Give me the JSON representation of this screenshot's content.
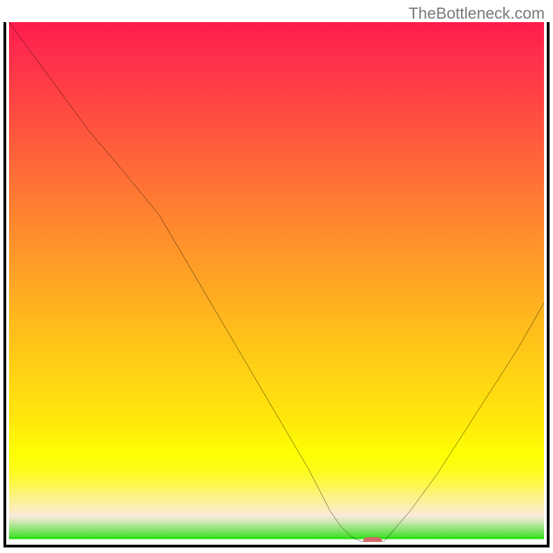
{
  "watermark": "TheBottleneck.com",
  "chart_data": {
    "type": "line",
    "title": "",
    "xlabel": "",
    "ylabel": "",
    "xlim": [
      0,
      100
    ],
    "ylim": [
      0,
      100
    ],
    "x": [
      0,
      5,
      10,
      15,
      20,
      24,
      28,
      32,
      36,
      40,
      44,
      48,
      52,
      56,
      58,
      60,
      62,
      64,
      66,
      70,
      75,
      80,
      85,
      90,
      95,
      100
    ],
    "values": [
      100,
      93,
      86,
      79,
      73,
      68,
      63,
      56,
      49,
      42,
      35,
      28,
      21,
      14,
      10,
      6,
      3,
      1,
      0,
      0,
      6,
      13,
      21,
      29,
      37,
      46
    ],
    "marker": {
      "x": 68,
      "y": 0
    },
    "annotations": [],
    "legend": [],
    "gradient_colors": {
      "top": "#fe1b4c",
      "mid": "#ffe60c",
      "bottom": "#1adf02"
    }
  }
}
